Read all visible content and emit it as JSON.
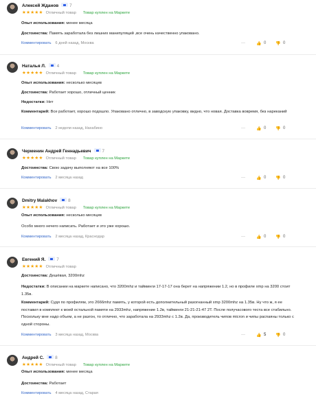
{
  "common": {
    "grade_word": "Отличный товар",
    "bought_label": "Товар куплен на Маркете",
    "comment_link": "Комментировать",
    "stars": "★★★★★",
    "more_glyph": "···",
    "like_glyph": "👍",
    "dislike_glyph": "👎"
  },
  "reviews": [
    {
      "name": "Алексей Жданов",
      "count": "7",
      "lines": [
        {
          "label": "Опыт использования:",
          "text": " менее месяца"
        },
        {
          "label": "Достоинства:",
          "text": " Память заработала без лишних манипуляций ,все очень качественно упаковано."
        }
      ],
      "meta": "6 дней назад, Москва",
      "likes": "0",
      "dislikes": "0"
    },
    {
      "name": "Наталья Л.",
      "count": "4",
      "lines": [
        {
          "label": "Опыт использования:",
          "text": " несколько месяцев"
        },
        {
          "label": "Достоинства:",
          "text": " Работает хорошо, отличный ценник"
        },
        {
          "label": "Недостатки:",
          "text": " Нет"
        },
        {
          "label": "Комментарий:",
          "text": " Все работает, хорошо подошло. Упаковано отлично, в заводскую упаковку, видно, что новая. Доставка вовремя, без нареканий"
        }
      ],
      "meta": "2 недели назад, Нахабино",
      "likes": "0",
      "dislikes": "0"
    },
    {
      "name": "Черменин Андрей Геннадьевич",
      "count": "7",
      "lines": [
        {
          "label": "Достоинства:",
          "text": " Свою задачу выполняют на все 100%"
        }
      ],
      "meta": "2 месяца назад",
      "likes": "0",
      "dislikes": "0"
    },
    {
      "name": "Dmitry Malakhov",
      "count": "8",
      "lines": [
        {
          "label": "Опыт использования:",
          "text": " несколько месяцев"
        },
        {
          "label": "",
          "text": "Особо много нечего написать. Работает и это уже хорошо."
        }
      ],
      "meta": "2 месяца назад, Краснодар",
      "likes": "0",
      "dislikes": "0"
    },
    {
      "name": "Евгений Я.",
      "count": "7",
      "lines": [
        {
          "label": "Достоинства:",
          "text": " Дешёвая, 3200mhz"
        },
        {
          "label": "Недостатки:",
          "text": " В описании на маркете написано, что 3200mhz и тайминги 17-17-17 она берет на напряжении 1.2, но в профиле xmp на 3200 стоит 1.35в."
        },
        {
          "label": "Комментарий:",
          "text": " Судя по профилям, это 2666mhz память, у которой есть дополнительный разогнанный xmp 3200mhz на 1.35в. Ну что ж, я ее поставил в комплект к моей остальной памяти на 2933mhz, напряжение 1.2в, тайминги 21-21-21-47 2T. После получасового теста все стабильно. Поскольку мне надо объем, а не разгон, то отлично, что заработала на 2933mhz с 1.2в. Да, производитель чипов micron и чипы распаяны только с одной стороны."
        }
      ],
      "meta": "3 месяца назад, Москва",
      "likes": "5",
      "dislikes": "0"
    },
    {
      "name": "Андрей С.",
      "count": "8",
      "lines": [
        {
          "label": "Опыт использования:",
          "text": " менее месяца"
        },
        {
          "label": "Достоинства:",
          "text": " Работает"
        }
      ],
      "meta": "4 месяца назад, Старая",
      "likes": "0",
      "dislikes": "0"
    }
  ]
}
